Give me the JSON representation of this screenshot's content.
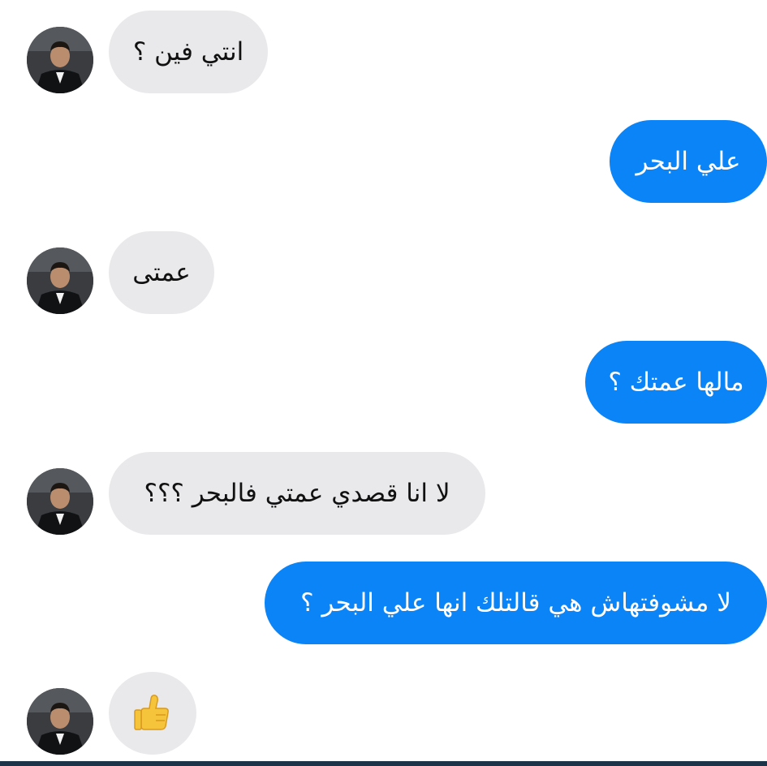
{
  "messages": [
    {
      "direction": "incoming",
      "text": "انتي فين ؟"
    },
    {
      "direction": "outgoing",
      "text": "علي البحر"
    },
    {
      "direction": "incoming",
      "text": "عمتى"
    },
    {
      "direction": "outgoing",
      "text": "مالها عمتك ؟"
    },
    {
      "direction": "incoming",
      "text": "لا انا قصدي عمتي فالبحر ؟؟؟"
    },
    {
      "direction": "outgoing",
      "text": "لا مشوفتهاش هي قالتلك انها علي البحر ؟"
    },
    {
      "direction": "incoming",
      "emoji": "thumbs-up"
    }
  ],
  "colors": {
    "incoming_bubble": "#e9e9eb",
    "outgoing_bubble": "#0a84f7",
    "bottom_bar": "#1d3348"
  },
  "icons": {
    "avatar": "contact-avatar-photo",
    "reaction": "thumbs-up-icon"
  }
}
